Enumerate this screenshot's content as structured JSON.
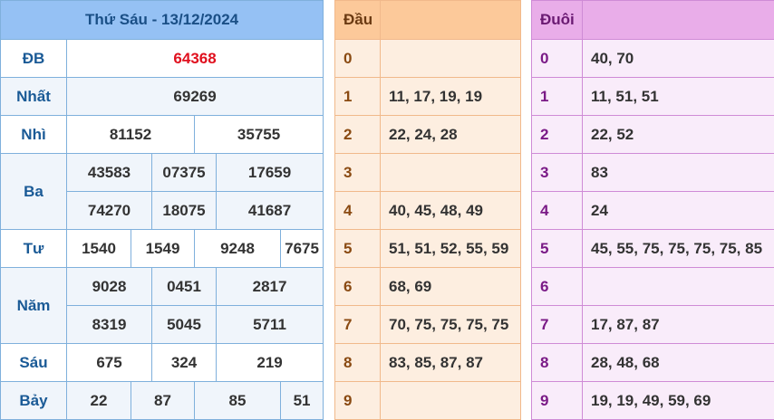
{
  "results": {
    "title": "Thứ Sáu - 13/12/2024",
    "db": {
      "label": "ĐB",
      "values": [
        "64368"
      ]
    },
    "nhat": {
      "label": "Nhất",
      "values": [
        "69269"
      ]
    },
    "nhi": {
      "label": "Nhì",
      "values": [
        "81152",
        "35755"
      ]
    },
    "ba": {
      "label": "Ba",
      "values": [
        "43583",
        "07375",
        "17659",
        "74270",
        "18075",
        "41687"
      ]
    },
    "tu": {
      "label": "Tư",
      "values": [
        "1540",
        "1549",
        "9248",
        "7675"
      ]
    },
    "nam": {
      "label": "Năm",
      "values": [
        "9028",
        "0451",
        "2817",
        "8319",
        "5045",
        "5711"
      ]
    },
    "sau": {
      "label": "Sáu",
      "values": [
        "675",
        "324",
        "219"
      ]
    },
    "bay": {
      "label": "Bảy",
      "values": [
        "22",
        "87",
        "85",
        "51"
      ]
    }
  },
  "head": {
    "title": "Đầu",
    "rows": [
      {
        "digit": "0",
        "values": ""
      },
      {
        "digit": "1",
        "values": "11, 17, 19, 19"
      },
      {
        "digit": "2",
        "values": "22, 24, 28"
      },
      {
        "digit": "3",
        "values": ""
      },
      {
        "digit": "4",
        "values": "40, 45, 48, 49"
      },
      {
        "digit": "5",
        "values": "51, 51, 52, 55, 59"
      },
      {
        "digit": "6",
        "values": "68, 69"
      },
      {
        "digit": "7",
        "values": "70, 75, 75, 75, 75"
      },
      {
        "digit": "8",
        "values": "83, 85, 87, 87"
      },
      {
        "digit": "9",
        "values": ""
      }
    ]
  },
  "tail": {
    "title": "Đuôi",
    "rows": [
      {
        "digit": "0",
        "values": "40, 70"
      },
      {
        "digit": "1",
        "values": "11, 51, 51"
      },
      {
        "digit": "2",
        "values": "22, 52"
      },
      {
        "digit": "3",
        "values": "83"
      },
      {
        "digit": "4",
        "values": "24"
      },
      {
        "digit": "5",
        "values": "45, 55, 75, 75, 75, 75, 85"
      },
      {
        "digit": "6",
        "values": ""
      },
      {
        "digit": "7",
        "values": "17, 87, 87"
      },
      {
        "digit": "8",
        "values": "28, 48, 68"
      },
      {
        "digit": "9",
        "values": "19, 19, 49, 59, 69"
      }
    ]
  }
}
